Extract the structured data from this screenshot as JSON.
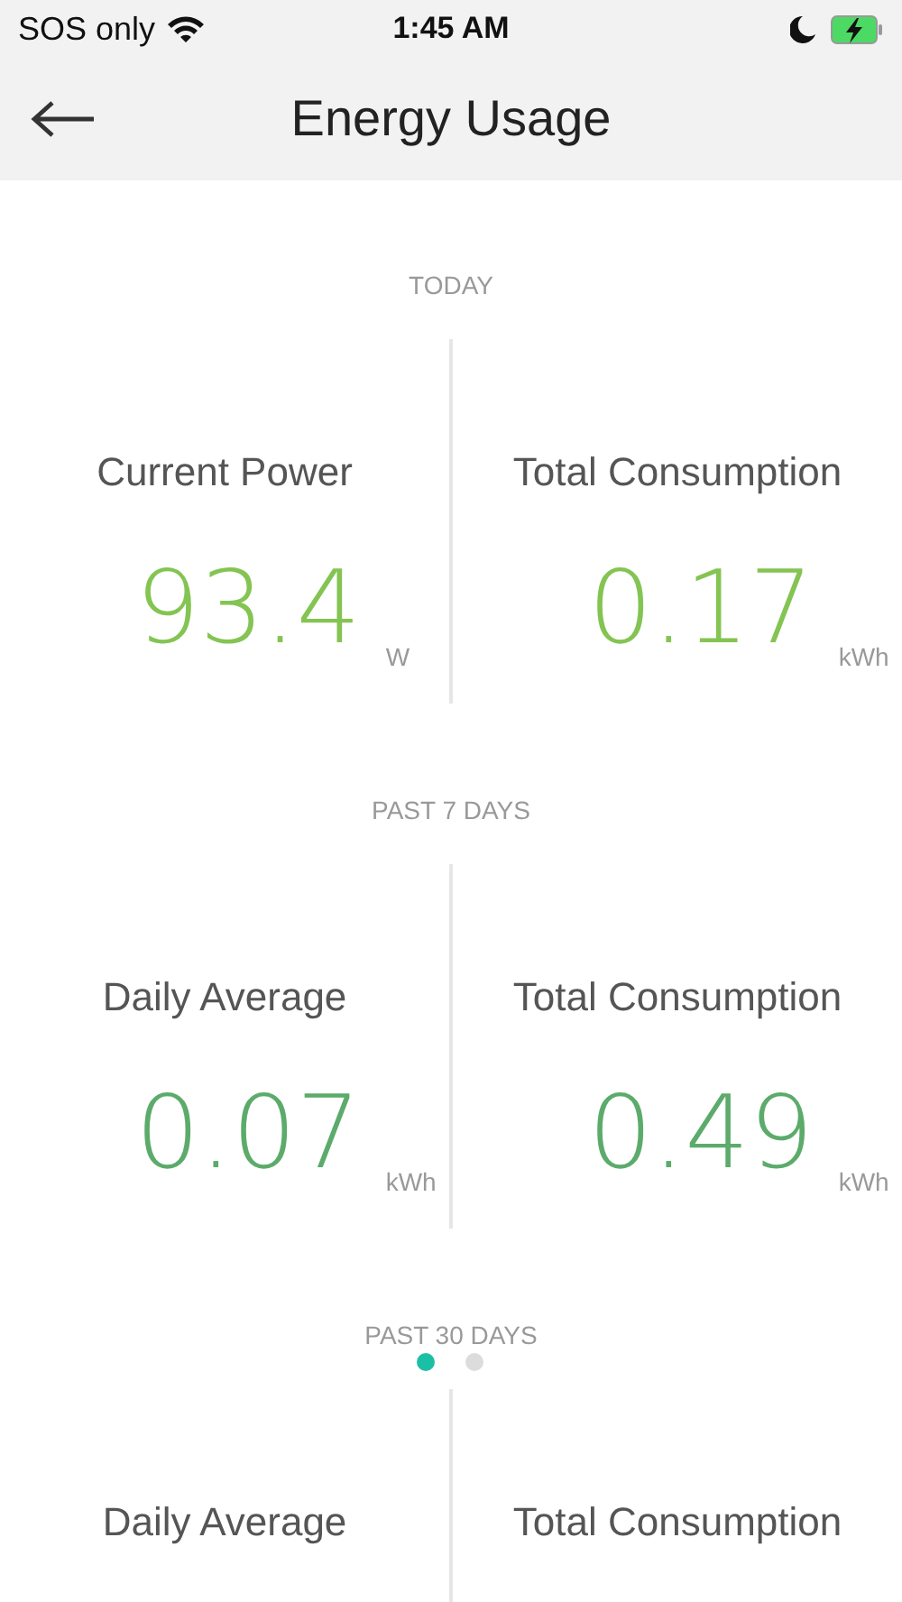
{
  "status_bar": {
    "carrier": "SOS only",
    "time": "1:45 AM"
  },
  "header": {
    "title": "Energy Usage"
  },
  "sections": [
    {
      "label": "TODAY",
      "stats": [
        {
          "label": "Current Power",
          "value": "93.4",
          "unit": "W",
          "color": "#84c452"
        },
        {
          "label": "Total Consumption",
          "value": "0.17",
          "unit": "kWh",
          "color": "#84c452"
        }
      ]
    },
    {
      "label": "PAST 7 DAYS",
      "stats": [
        {
          "label": "Daily Average",
          "value": "0.07",
          "unit": "kWh",
          "color": "#5cab6b"
        },
        {
          "label": "Total Consumption",
          "value": "0.49",
          "unit": "kWh",
          "color": "#5cab6b"
        }
      ]
    },
    {
      "label": "PAST 30 DAYS",
      "stats": [
        {
          "label": "Daily Average"
        },
        {
          "label": "Total Consumption"
        }
      ]
    }
  ],
  "page_indicator": [
    {
      "selected": true
    },
    {
      "selected": false
    }
  ]
}
